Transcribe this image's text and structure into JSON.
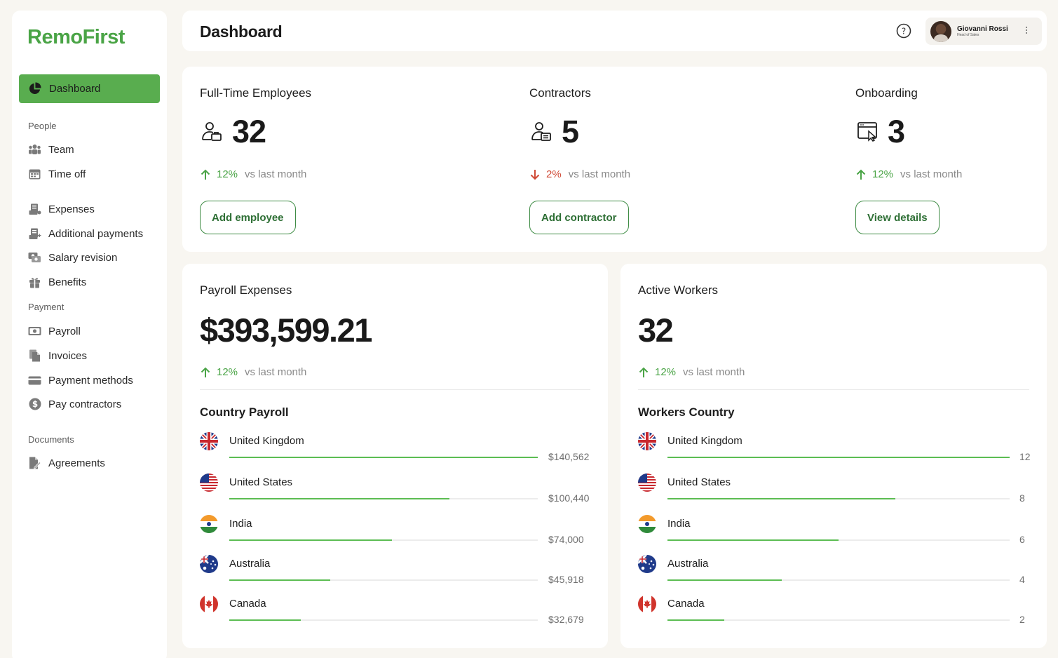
{
  "brand": {
    "name": "RemoFirst"
  },
  "sidebar": {
    "active": {
      "label": "Dashboard",
      "icon": "pie-chart-icon"
    },
    "sections": [
      {
        "label": "People",
        "items": [
          {
            "label": "Team",
            "icon": "team-icon"
          },
          {
            "label": "Time off",
            "icon": "calendar-icon"
          },
          {
            "label": "Expenses",
            "icon": "receipt-icon"
          },
          {
            "label": "Additional payments",
            "icon": "receipt-plus-icon"
          },
          {
            "label": "Salary revision",
            "icon": "salary-icon"
          },
          {
            "label": "Benefits",
            "icon": "gift-icon"
          }
        ]
      },
      {
        "label": "Payment",
        "items": [
          {
            "label": "Payroll",
            "icon": "banknote-icon"
          },
          {
            "label": "Invoices",
            "icon": "documents-icon"
          },
          {
            "label": "Payment methods",
            "icon": "credit-card-icon"
          },
          {
            "label": "Pay contractors",
            "icon": "dollar-coin-icon"
          }
        ]
      },
      {
        "label": "Documents",
        "items": [
          {
            "label": "Agreements",
            "icon": "signed-document-icon"
          }
        ]
      }
    ]
  },
  "header": {
    "title": "Dashboard",
    "user": {
      "name": "Giovanni Rossi",
      "role": "Head of Sales"
    }
  },
  "stats": [
    {
      "title": "Full-Time Employees",
      "value": "32",
      "trend_dir": "up",
      "trend_pct": "12%",
      "trend_text": "vs last month",
      "button": "Add employee",
      "icon": "employee-badge-icon"
    },
    {
      "title": "Contractors",
      "value": "5",
      "trend_dir": "down",
      "trend_pct": "2%",
      "trend_text": "vs last month",
      "button": "Add contractor",
      "icon": "contractor-card-icon"
    },
    {
      "title": "Onboarding",
      "value": "3",
      "trend_dir": "up",
      "trend_pct": "12%",
      "trend_text": "vs last month",
      "button": "View details",
      "icon": "browser-window-icon"
    }
  ],
  "payroll": {
    "title": "Payroll Expenses",
    "value": "$393,599.21",
    "trend_pct": "12%",
    "trend_text": "vs last month",
    "subtitle": "Country Payroll",
    "rows": [
      {
        "country": "United Kingdom",
        "value": "$140,562",
        "amount": 140562
      },
      {
        "country": "United States",
        "value": "$100,440",
        "amount": 100440
      },
      {
        "country": "India",
        "value": "$74,000",
        "amount": 74000
      },
      {
        "country": "Australia",
        "value": "$45,918",
        "amount": 45918
      },
      {
        "country": "Canada",
        "value": "$32,679",
        "amount": 32679
      }
    ]
  },
  "workers": {
    "title": "Active Workers",
    "value": "32",
    "trend_pct": "12%",
    "trend_text": "vs last month",
    "subtitle": "Workers Country",
    "rows": [
      {
        "country": "United Kingdom",
        "value": "12",
        "amount": 12
      },
      {
        "country": "United States",
        "value": "8",
        "amount": 8
      },
      {
        "country": "India",
        "value": "6",
        "amount": 6
      },
      {
        "country": "Australia",
        "value": "4",
        "amount": 4
      },
      {
        "country": "Canada",
        "value": "2",
        "amount": 2
      }
    ]
  },
  "colors": {
    "accent": "#59ad4f",
    "brand": "#4aa446",
    "up": "#4aa446",
    "down": "#d04a36",
    "bar": "#5cbd53"
  }
}
